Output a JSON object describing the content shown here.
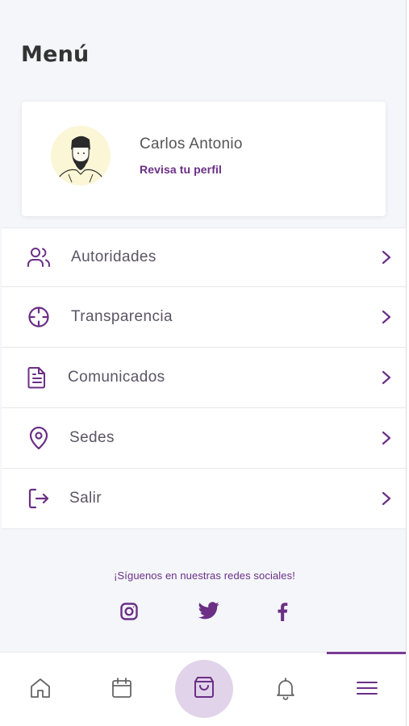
{
  "header": {
    "title": "Menú"
  },
  "profile": {
    "name": "Carlos Antonio",
    "link_label": "Revisa tu perfil"
  },
  "menu": {
    "items": [
      {
        "label": "Autoridades",
        "icon": "users-icon"
      },
      {
        "label": "Transparencia",
        "icon": "crosshair-icon"
      },
      {
        "label": "Comunicados",
        "icon": "document-icon"
      },
      {
        "label": "Sedes",
        "icon": "location-pin-icon"
      },
      {
        "label": "Salir",
        "icon": "logout-icon"
      }
    ]
  },
  "social": {
    "text": "¡Síguenos en nuestras redes sociales!",
    "networks": [
      "instagram-icon",
      "twitter-icon",
      "facebook-icon"
    ]
  },
  "bottom_nav": {
    "items": [
      "home-icon",
      "calendar-icon",
      "shopping-bag-icon",
      "bell-icon",
      "menu-icon"
    ],
    "active": "menu-icon"
  },
  "colors": {
    "accent": "#6b2f86",
    "background": "#f4f6fa",
    "center_button": "#e1d4ea"
  }
}
